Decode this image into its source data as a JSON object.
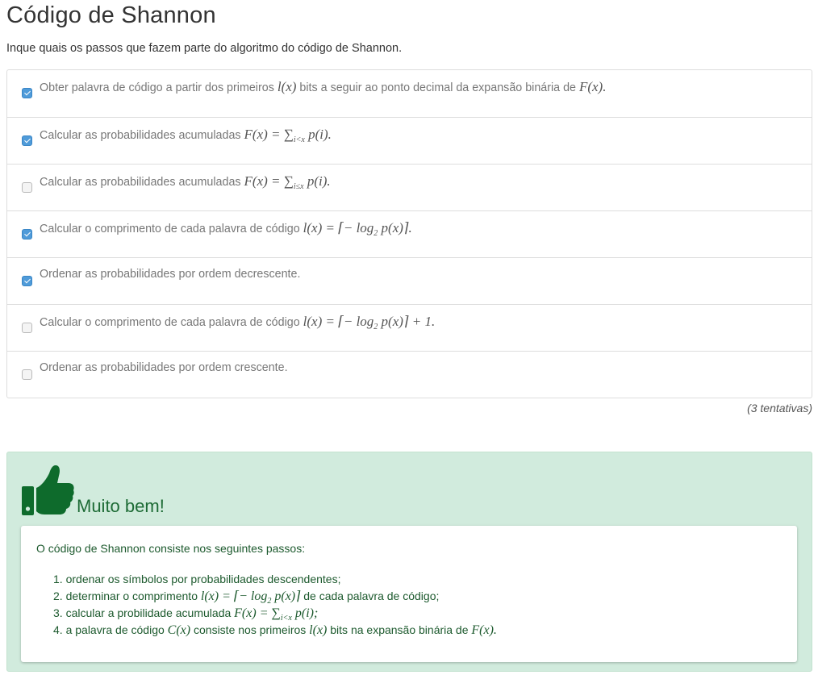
{
  "page": {
    "title": "Código de Shannon",
    "instructions": "Inque quais os passos que fazem parte do algoritmo do código de Shannon."
  },
  "options": [
    {
      "checked": true,
      "text": "Obter palavra de código a partir dos primeiros",
      "math": "l(x)",
      "text2": "bits a seguir ao ponto decimal da expansão binária de",
      "math2": "F(x)."
    },
    {
      "checked": true,
      "text": "Calcular as probabilidades acumuladas",
      "math": "F(x) = ∑",
      "sub": "i<x",
      "math2": "p(i)."
    },
    {
      "checked": false,
      "text": "Calcular as probabilidades acumuladas",
      "math": "F(x) = ∑",
      "sub": "i≤x",
      "math2": "p(i)."
    },
    {
      "checked": true,
      "text": "Calcular o comprimento de cada palavra de código",
      "math": "l(x) = ⌈− log",
      "sub": "2",
      "math2": "p(x)⌉."
    },
    {
      "checked": true,
      "text": "Ordenar as probabilidades por ordem decrescente."
    },
    {
      "checked": false,
      "text": "Calcular o comprimento de cada palavra de código",
      "math": "l(x) = ⌈− log",
      "sub": "2",
      "math2": "p(x)⌉ + 1."
    },
    {
      "checked": false,
      "text": "Ordenar as probabilidades por ordem crescente."
    }
  ],
  "attempts": "(3 tentativas)",
  "feedback": {
    "title": "Muito bem!",
    "intro": "O código de Shannon consiste nos seguintes passos:",
    "steps": [
      {
        "num": "1.",
        "text": "ordenar os símbolos por probabilidades descendentes;"
      },
      {
        "num": "2.",
        "text": "determinar o comprimento",
        "math": "l(x) = ⌈− log",
        "sub": "2",
        "math2": "p(x)⌉",
        "text2": "de cada palavra de código;"
      },
      {
        "num": "3.",
        "text": "calcular a probilidade acumulada",
        "math": "F(x) = ∑",
        "sub": "i<x",
        "math2": "p(i);"
      },
      {
        "num": "4.",
        "text": "a palavra de código",
        "math": "C(x)",
        "text2": "consiste nos primeiros",
        "math3": "l(x)",
        "text3": "bits na expansão binária de",
        "math4": "F(x)."
      }
    ]
  },
  "colors": {
    "accent_checkbox": "#4f9bd9",
    "success_bg": "#d1ebdd",
    "success_text": "#1d6b35"
  },
  "icons": {
    "feedback_icon": "thumbs-up-icon"
  }
}
